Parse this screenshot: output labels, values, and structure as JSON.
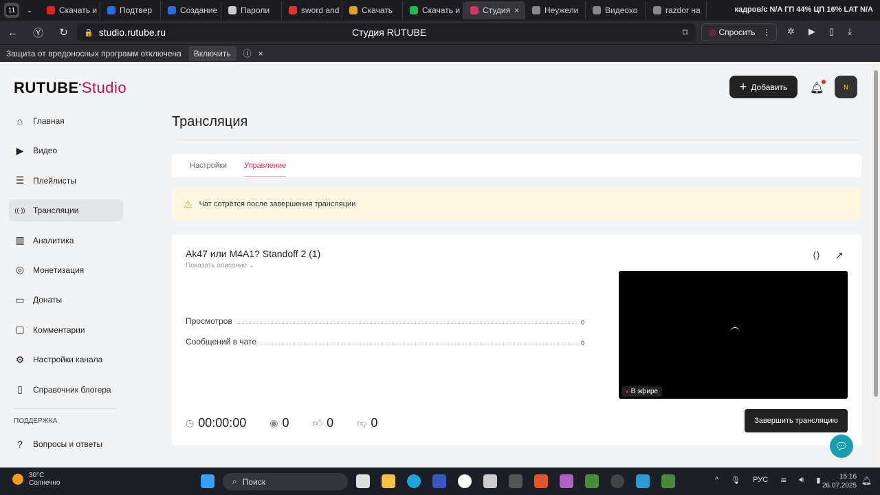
{
  "browser": {
    "tab_count": "11",
    "tabs": [
      {
        "label": "Скачать и",
        "color": "#d22"
      },
      {
        "label": "Подтвер",
        "color": "#2a6be0"
      },
      {
        "label": "Создание",
        "color": "#2a6be0"
      },
      {
        "label": "Пароли",
        "color": "#ccc"
      },
      {
        "label": "sword and",
        "color": "#d33"
      },
      {
        "label": "Скачать",
        "color": "#e0a020"
      },
      {
        "label": "Скачать и",
        "color": "#1db954"
      },
      {
        "label": "Студия",
        "color": "#d6335f",
        "active": true
      },
      {
        "label": "Неужели",
        "color": "#888"
      },
      {
        "label": "Видеохо",
        "color": "#888"
      },
      {
        "label": "razdor на",
        "color": "#888"
      }
    ],
    "sys_overlay": "кадров/с N/A  ГП 44%  ЦП 16%  LAT N/A",
    "url": "studio.rutube.ru",
    "page_title": "Студия RUTUBE",
    "ask_label": "Спросить",
    "warning": "Защита от вредоносных программ отключена",
    "warning_enable": "Включить"
  },
  "header": {
    "logo_main": "RUTUBE",
    "logo_sub": "Studio",
    "add_label": "Добавить"
  },
  "sidebar": {
    "items": [
      {
        "label": "Главная",
        "icon": "home-icon"
      },
      {
        "label": "Видео",
        "icon": "video-icon"
      },
      {
        "label": "Плейлисты",
        "icon": "playlist-icon"
      },
      {
        "label": "Трансляции",
        "icon": "broadcast-icon",
        "active": true
      },
      {
        "label": "Аналитика",
        "icon": "analytics-icon"
      },
      {
        "label": "Монетизация",
        "icon": "monetization-icon"
      },
      {
        "label": "Донаты",
        "icon": "donate-icon"
      },
      {
        "label": "Комментарии",
        "icon": "comments-icon"
      },
      {
        "label": "Настройки канала",
        "icon": "settings-icon"
      },
      {
        "label": "Справочник блогера",
        "icon": "book-icon"
      }
    ],
    "support_label": "ПОДДЕРЖКА",
    "support_items": [
      {
        "label": "Вопросы и ответы"
      }
    ]
  },
  "main": {
    "title": "Трансляция",
    "tabs": [
      {
        "label": "Настройки"
      },
      {
        "label": "Управление",
        "active": true
      }
    ],
    "alert": "Чат сотрётся после завершения трансляции",
    "stream": {
      "title": "Ak47 или M4A1? Standoff 2 (1)",
      "show_description": "Показать описание",
      "stats": [
        {
          "label": "Просмотров",
          "value": "0"
        },
        {
          "label": "Сообщений в чате",
          "value": "0"
        }
      ],
      "live_badge": "В эфире",
      "timer": "00:00:00",
      "viewers": "0",
      "likes": "0",
      "dislikes": "0",
      "end_label": "Завершить трансляцию"
    }
  },
  "taskbar": {
    "temp": "30°C",
    "weather": "Солнечно",
    "search": "Поиск",
    "lang": "РУС",
    "time": "15:16",
    "date": "26.07.2025"
  }
}
